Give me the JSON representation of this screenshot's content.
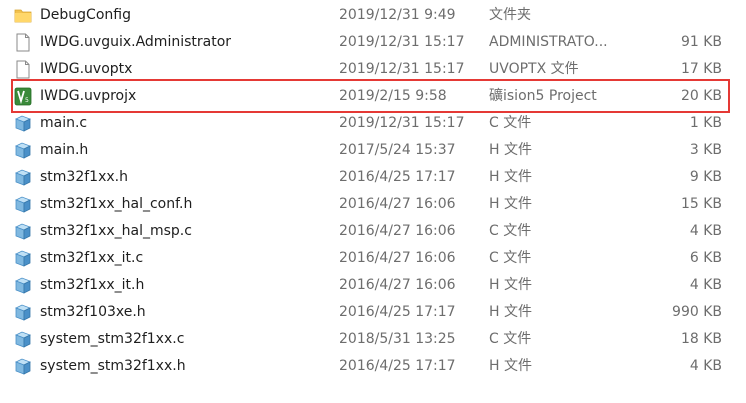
{
  "files": [
    {
      "icon": "folder-icon",
      "name": "DebugConfig",
      "date": "2019/12/31 9:49",
      "type": "文件夹",
      "size": ""
    },
    {
      "icon": "document-icon",
      "name": "IWDG.uvguix.Administrator",
      "date": "2019/12/31 15:17",
      "type": "ADMINISTRATO...",
      "size": "91 KB"
    },
    {
      "icon": "document-icon",
      "name": "IWDG.uvoptx",
      "date": "2019/12/31 15:17",
      "type": "UVOPTX 文件",
      "size": "17 KB"
    },
    {
      "icon": "keil-project-icon",
      "name": "IWDG.uvprojx",
      "date": "2019/2/15 9:58",
      "type": "礦ision5 Project",
      "size": "20 KB"
    },
    {
      "icon": "c-source-icon",
      "name": "main.c",
      "date": "2019/12/31 15:17",
      "type": "C 文件",
      "size": "1 KB"
    },
    {
      "icon": "c-source-icon",
      "name": "main.h",
      "date": "2017/5/24 15:37",
      "type": "H 文件",
      "size": "3 KB"
    },
    {
      "icon": "c-source-icon",
      "name": "stm32f1xx.h",
      "date": "2016/4/25 17:17",
      "type": "H 文件",
      "size": "9 KB"
    },
    {
      "icon": "c-source-icon",
      "name": "stm32f1xx_hal_conf.h",
      "date": "2016/4/27 16:06",
      "type": "H 文件",
      "size": "15 KB"
    },
    {
      "icon": "c-source-icon",
      "name": "stm32f1xx_hal_msp.c",
      "date": "2016/4/27 16:06",
      "type": "C 文件",
      "size": "4 KB"
    },
    {
      "icon": "c-source-icon",
      "name": "stm32f1xx_it.c",
      "date": "2016/4/27 16:06",
      "type": "C 文件",
      "size": "6 KB"
    },
    {
      "icon": "c-source-icon",
      "name": "stm32f1xx_it.h",
      "date": "2016/4/27 16:06",
      "type": "H 文件",
      "size": "4 KB"
    },
    {
      "icon": "c-source-icon",
      "name": "stm32f103xe.h",
      "date": "2016/4/25 17:17",
      "type": "H 文件",
      "size": "990 KB"
    },
    {
      "icon": "c-source-icon",
      "name": "system_stm32f1xx.c",
      "date": "2018/5/31 13:25",
      "type": "C 文件",
      "size": "18 KB"
    },
    {
      "icon": "c-source-icon",
      "name": "system_stm32f1xx.h",
      "date": "2016/4/25 17:17",
      "type": "H 文件",
      "size": "4 KB"
    }
  ],
  "highlighted_file": "IWDG.uvprojx",
  "colors": {
    "highlight_border": "#e53935",
    "folder": "#f2c14e",
    "keil_green": "#3a8a3a",
    "source_icon_blue": "#4a90c8"
  }
}
